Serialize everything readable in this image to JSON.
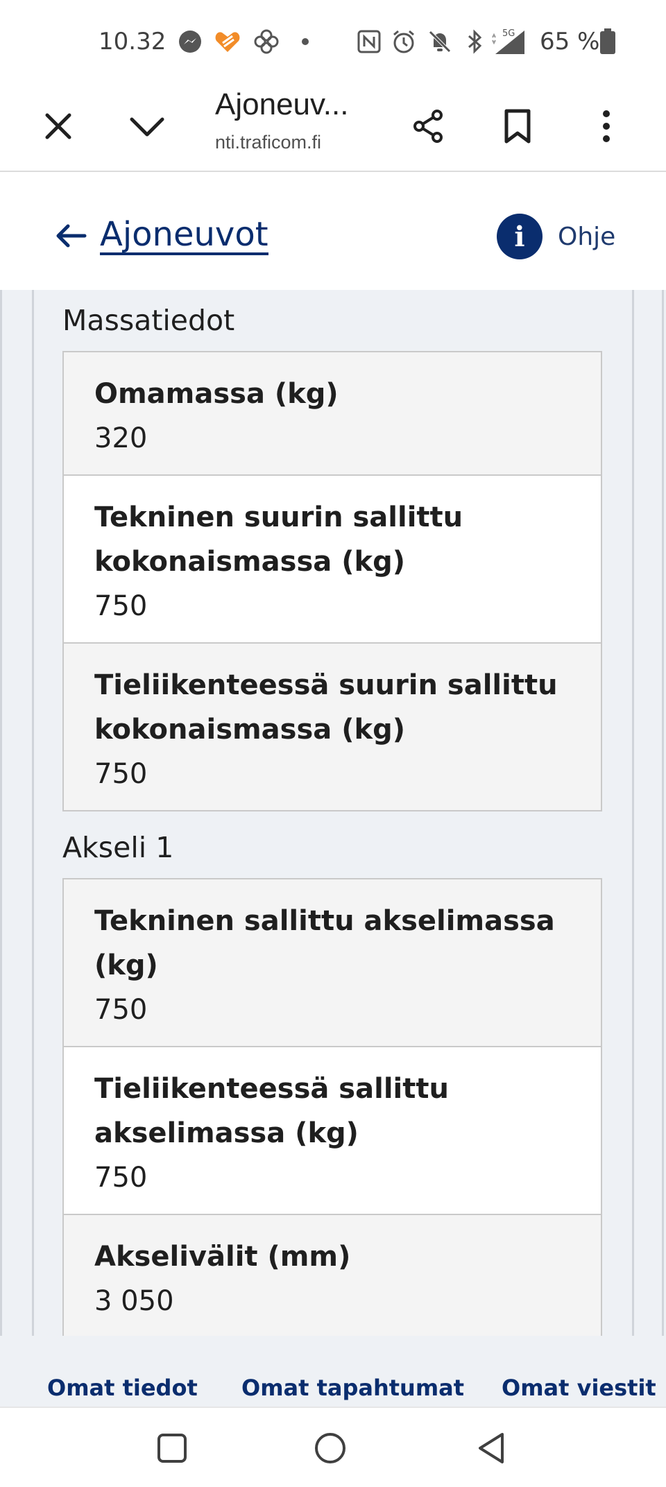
{
  "status_bar": {
    "time": "10.32",
    "battery": "65 %",
    "icons": [
      "messenger-icon",
      "heart-app-icon",
      "pinwheel-app-icon",
      "dot-icon",
      "nfc-icon",
      "alarm-icon",
      "mute-icon",
      "bluetooth-icon",
      "signal-5g-icon",
      "battery-icon"
    ],
    "network_label": "5G"
  },
  "browser": {
    "title": "Ajoneuv...",
    "url": "nti.traficom.fi",
    "buttons": [
      "close-icon",
      "chevron-down-icon",
      "share-icon",
      "bookmark-icon",
      "more-vert-icon"
    ]
  },
  "header": {
    "back_label": "Ajoneuvot",
    "help_label": "Ohje",
    "help_icon_char": "i"
  },
  "sections": [
    {
      "title": "Massatiedot",
      "rows": [
        {
          "label": "Omamassa (kg)",
          "value": "320"
        },
        {
          "label": "Tekninen suurin sallittu kokonaismassa (kg)",
          "value": "750"
        },
        {
          "label": "Tieliikenteessä suurin sallittu kokonaismassa (kg)",
          "value": "750"
        }
      ]
    },
    {
      "title": "Akseli 1",
      "rows": [
        {
          "label": "Tekninen sallittu akselimassa (kg)",
          "value": "750"
        },
        {
          "label": "Tieliikenteessä sallittu akselimassa (kg)",
          "value": "750"
        },
        {
          "label": "Akselivälit (mm)",
          "value": "3 050"
        }
      ]
    }
  ],
  "bottom_nav": {
    "items": [
      "Omat tiedot",
      "Omat tapahtumat",
      "Omat viestit"
    ]
  },
  "colors": {
    "brand_navy": "#0a2d6e",
    "panel_bg": "#eef1f5"
  }
}
